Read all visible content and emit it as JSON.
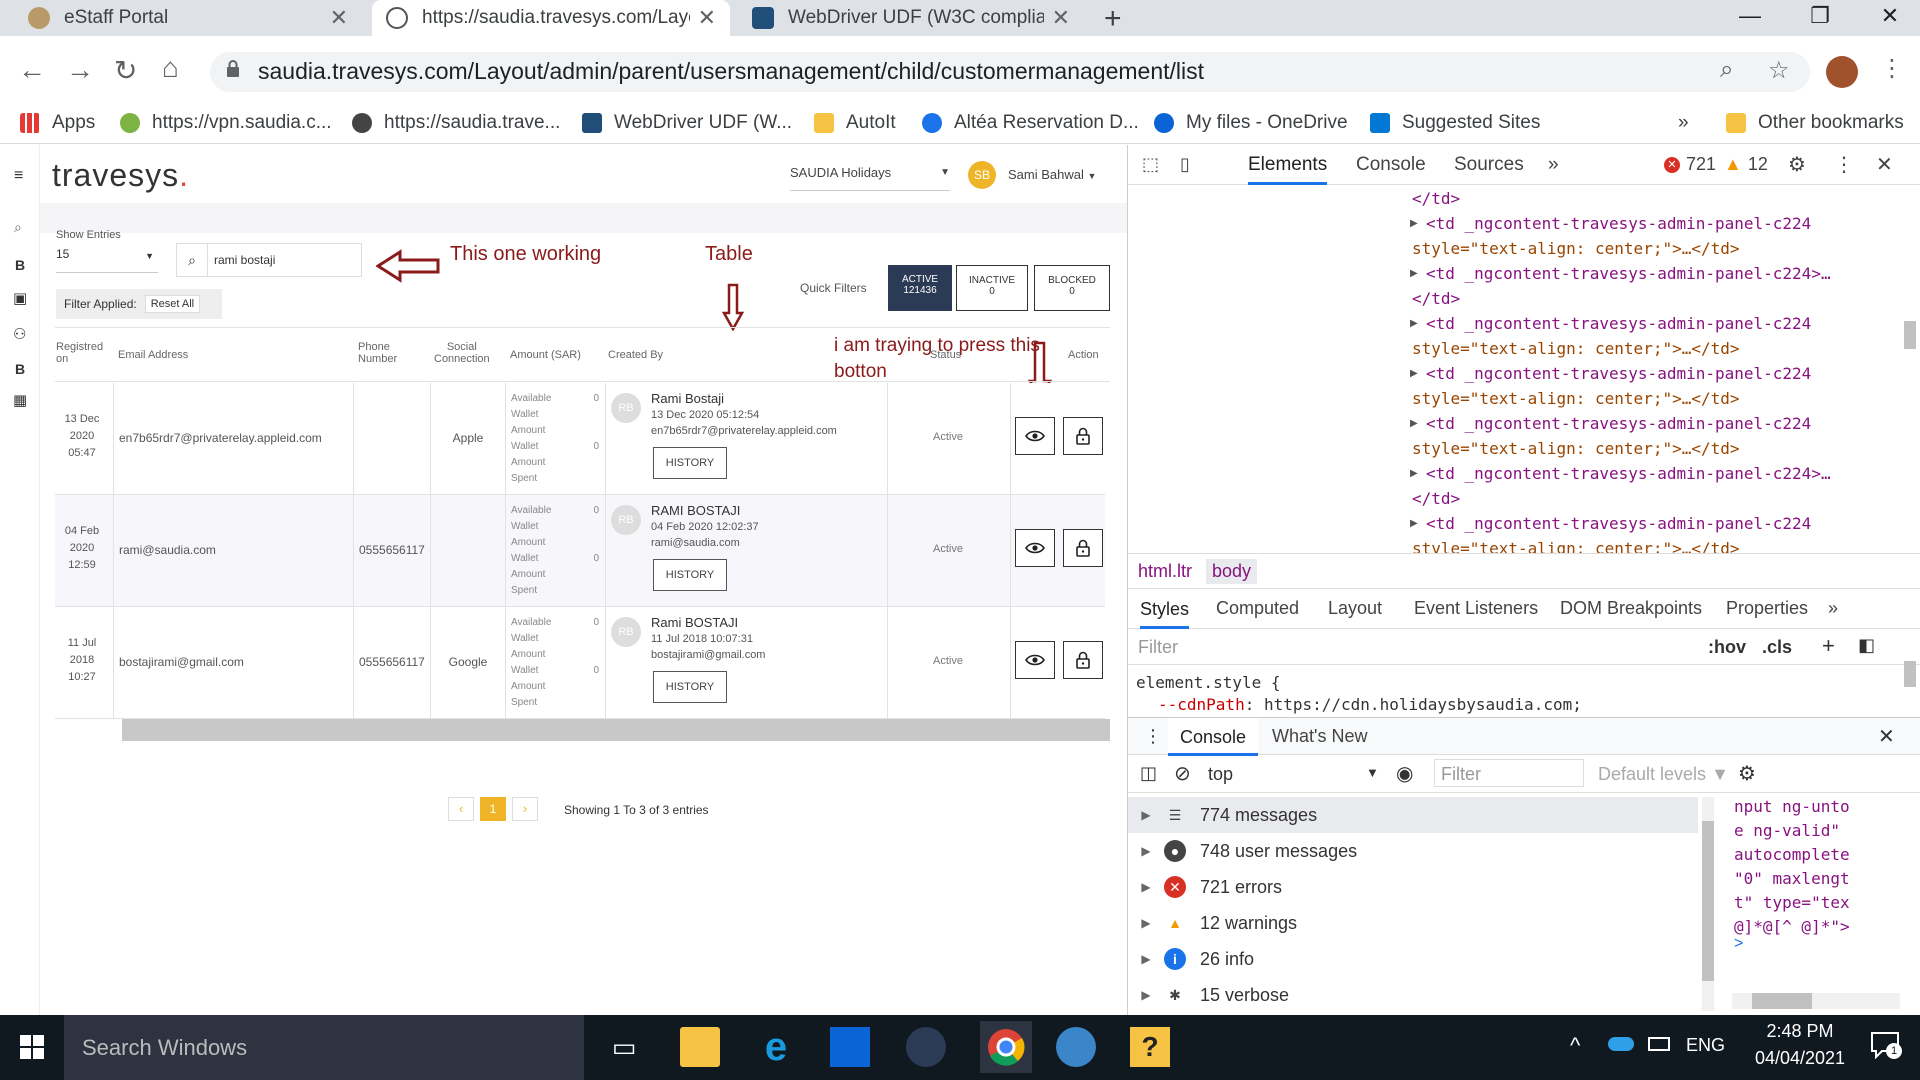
{
  "browser": {
    "tabs": [
      {
        "title": "eStaff Portal",
        "active": false
      },
      {
        "title": "https://saudia.travesys.com/Layo",
        "active": true
      },
      {
        "title": "WebDriver UDF (W3C compliant",
        "active": false
      }
    ],
    "url": "saudia.travesys.com/Layout/admin/parent/usersmanagement/child/customermanagement/list",
    "bookmarks": [
      "Apps",
      "https://vpn.saudia.c...",
      "https://saudia.trave...",
      "WebDriver UDF (W...",
      "AutoIt",
      "Altéa Reservation D...",
      "My files - OneDrive",
      "Suggested Sites"
    ],
    "more_bookmarks": "»",
    "other_bookmarks": "Other bookmarks"
  },
  "app": {
    "logo_text": "travesys",
    "logo_dot": ".",
    "brand_select": "SAUDIA Holidays",
    "user_initials": "SB",
    "user_name": "Sami Bahwal",
    "rail_letters": [
      "B",
      "B"
    ],
    "show_entries_label": "Show Entries",
    "entries_value": "15",
    "search_value": "rami bostaji",
    "filter_applied_label": "Filter Applied:",
    "reset_all_label": "Reset All",
    "quick_filters_label": "Quick Filters",
    "filters": [
      {
        "label": "ACTIVE",
        "count": "121436",
        "selected": true
      },
      {
        "label": "INACTIVE",
        "count": "0",
        "selected": false
      },
      {
        "label": "BLOCKED",
        "count": "0",
        "selected": false
      }
    ],
    "columns": [
      "Registred",
      "on",
      "Email Address",
      "Phone",
      "Number",
      "Social",
      "Connection",
      "Amount (SAR)",
      "Created By",
      "Status",
      "Action"
    ],
    "amount_labels": [
      "Available",
      "Wallet",
      "Amount",
      "Wallet",
      "Amount",
      "Spent"
    ],
    "history_label": "HISTORY",
    "rows": [
      {
        "date": "13 Dec",
        "year": "2020",
        "time": "05:47",
        "email": "en7b65rdr7@privaterelay.appleid.com",
        "phone": "",
        "social": "Apple",
        "available": "0",
        "spent": "0",
        "avatar": "RB",
        "creator": "Rami Bostaji",
        "created": "13 Dec 2020 05:12:54",
        "creator_email": "en7b65rdr7@privaterelay.appleid.com",
        "status": "Active"
      },
      {
        "date": "04 Feb",
        "year": "2020",
        "time": "12:59",
        "email": "rami@saudia.com",
        "phone": "0555656117",
        "social": "",
        "available": "0",
        "spent": "0",
        "avatar": "RB",
        "creator": "RAMI BOSTAJI",
        "created": "04 Feb 2020 12:02:37",
        "creator_email": "rami@saudia.com",
        "status": "Active"
      },
      {
        "date": "11 Jul",
        "year": "2018",
        "time": "10:27",
        "email": "bostajirami@gmail.com",
        "phone": "0555656117",
        "social": "Google",
        "available": "0",
        "spent": "0",
        "avatar": "RB",
        "creator": "Rami BOSTAJI",
        "created": "11 Jul 2018 10:07:31",
        "creator_email": "bostajirami@gmail.com",
        "status": "Active"
      }
    ],
    "pagination": {
      "current": "1",
      "summary": "Showing 1 To 3 of 3 entries"
    }
  },
  "annotations": {
    "working": "This one working",
    "table": "Table",
    "press_line1": "i am traying to press this",
    "press_line2": "botton"
  },
  "devtools": {
    "tabs": [
      "Elements",
      "Console",
      "Sources",
      "»"
    ],
    "error_count": "721",
    "warning_count": "12",
    "code_lines": [
      {
        "t": "close",
        "text": "</td>"
      },
      {
        "t": "open",
        "text": "<td _ngcontent-travesys-admin-panel-c224"
      },
      {
        "t": "style",
        "text": "style=\"text-align: center;\">…</td>"
      },
      {
        "t": "open",
        "text": "<td _ngcontent-travesys-admin-panel-c224>…"
      },
      {
        "t": "close",
        "text": "</td>"
      },
      {
        "t": "open",
        "text": "<td _ngcontent-travesys-admin-panel-c224"
      },
      {
        "t": "style",
        "text": "style=\"text-align: center;\">…</td>"
      },
      {
        "t": "open",
        "text": "<td _ngcontent-travesys-admin-panel-c224"
      },
      {
        "t": "style",
        "text": "style=\"text-align: center;\">…</td>"
      },
      {
        "t": "open",
        "text": "<td _ngcontent-travesys-admin-panel-c224"
      },
      {
        "t": "style",
        "text": "style=\"text-align: center;\">…</td>"
      },
      {
        "t": "open",
        "text": "<td _ngcontent-travesys-admin-panel-c224>…"
      },
      {
        "t": "close",
        "text": "</td>"
      },
      {
        "t": "open",
        "text": "<td _ngcontent-travesys-admin-panel-c224"
      },
      {
        "t": "style",
        "text": "style=\"text-align: center;\">…</td>"
      }
    ],
    "breadcrumb": [
      "html.ltr",
      "body"
    ],
    "style_tabs": [
      "Styles",
      "Computed",
      "Layout",
      "Event Listeners",
      "DOM Breakpoints",
      "Properties",
      "»"
    ],
    "filter_placeholder": "Filter",
    "hov": ":hov",
    "cls": ".cls",
    "element_style": "element.style {",
    "css_prop": "--cdnPath",
    "css_val": "https://cdn.holidaysbysaudia.com;",
    "drawer_tabs": [
      "Console",
      "What's New"
    ],
    "context": "top",
    "console_filter_placeholder": "Filter",
    "levels": "Default levels",
    "messages": [
      {
        "text": "774 messages",
        "kind": "list"
      },
      {
        "text": "748 user messages",
        "kind": "user"
      },
      {
        "text": "721 errors",
        "kind": "error"
      },
      {
        "text": "12 warnings",
        "kind": "warn"
      },
      {
        "text": "26 info",
        "kind": "info"
      },
      {
        "text": "15 verbose",
        "kind": "verbose"
      }
    ],
    "side_code": [
      "nput ng-unto",
      "e ng-valid\"",
      "autocomplete",
      "\"0\" maxlengt",
      "t\" type=\"tex",
      "@]*@[^ @]*\">"
    ],
    "prompt": ">"
  },
  "taskbar": {
    "search_placeholder": "Search Windows",
    "lang": "ENG",
    "time": "2:48 PM",
    "date": "04/04/2021",
    "notification_count": "1"
  },
  "colors": {
    "accent": "#2b3a55",
    "annotation": "#8b1a1a",
    "pager": "#f0b428"
  }
}
